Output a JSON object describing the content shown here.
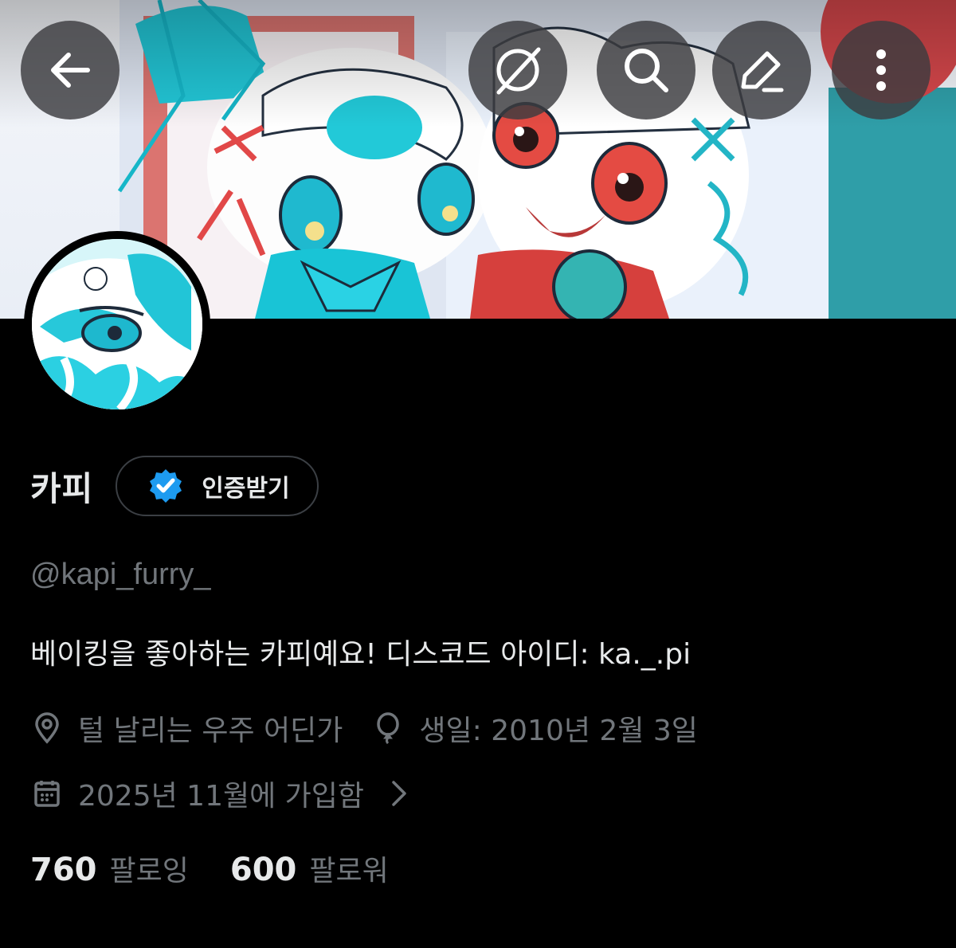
{
  "toolbar": {
    "back_icon": "arrow-left-icon",
    "grok_icon": "grok-icon",
    "search_icon": "search-icon",
    "edit_icon": "edit-icon",
    "more_icon": "more-vertical-icon"
  },
  "profile": {
    "display_name": "카피",
    "verify_label": "인증받기",
    "handle": "@kapi_furry_",
    "bio": "베이킹을 좋아하는 카피예요! 디스코드 아이디: ka._.pi",
    "location": "털 날리는 우주 어딘가",
    "birthday": "생일: 2010년 2월 3일",
    "joined": "2025년 11월에 가입함"
  },
  "stats": {
    "following_count": "760",
    "following_label": "팔로잉",
    "followers_count": "600",
    "followers_label": "팔로워"
  },
  "colors": {
    "background": "#000000",
    "text_primary": "#e7e9ea",
    "text_secondary": "#71767b",
    "verified_blue": "#1d9bf0"
  }
}
